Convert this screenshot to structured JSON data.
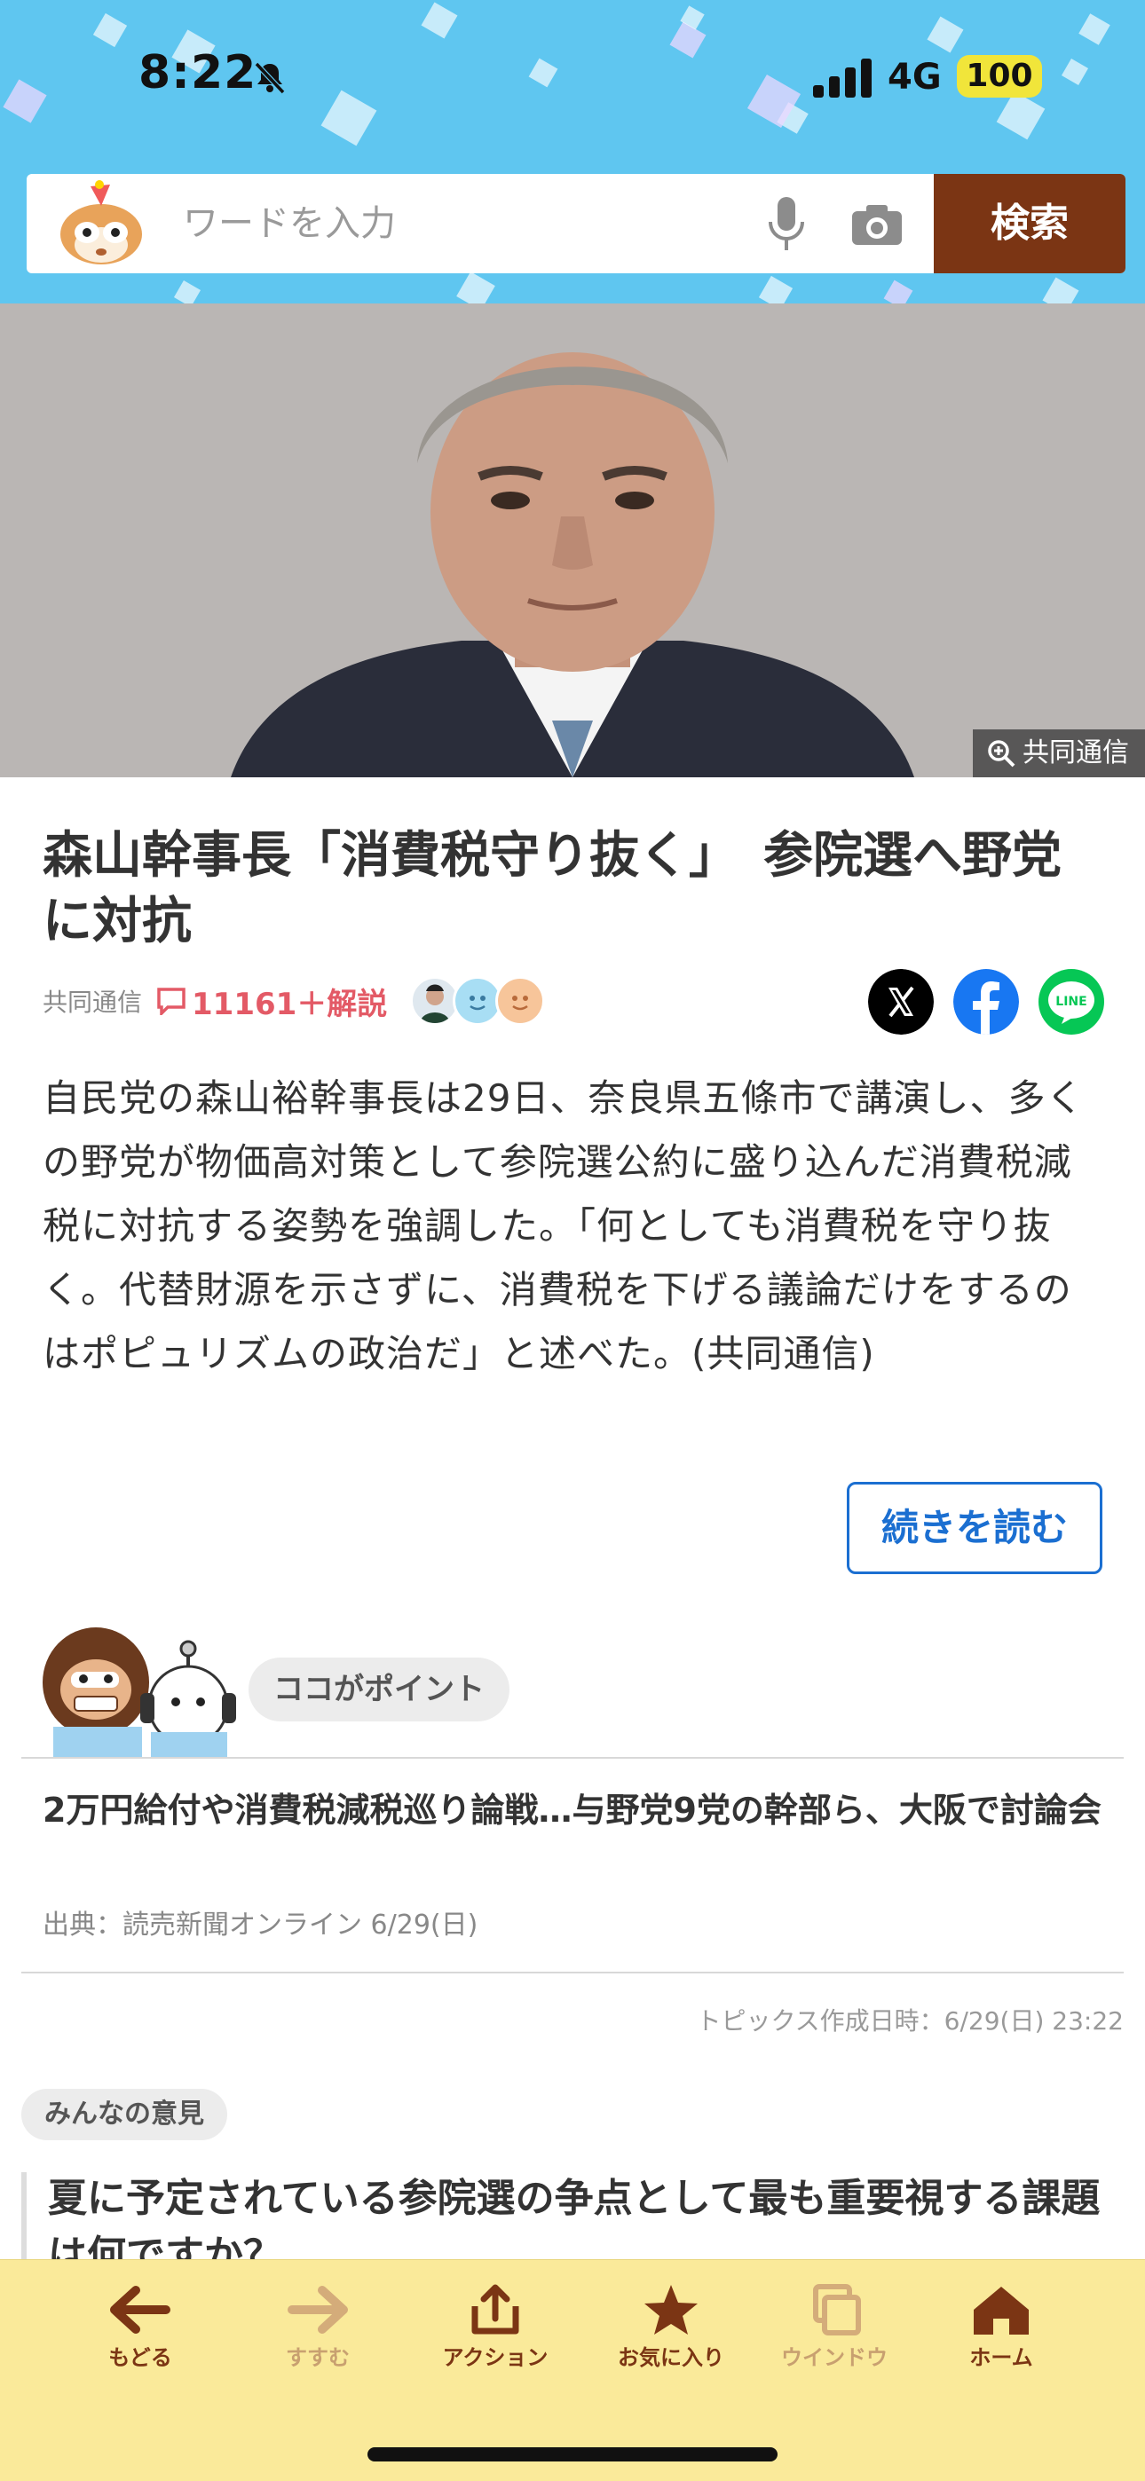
{
  "status": {
    "time": "8:22",
    "network": "4G",
    "battery": "100"
  },
  "search": {
    "placeholder": "ワードを入力",
    "button": "検索"
  },
  "hero": {
    "credit": "共同通信"
  },
  "article": {
    "title": "森山幹事長「消費税守り抜く」　参院選へ野党に対抗",
    "source": "共同通信",
    "comments": "11161＋解説",
    "body": "自民党の森山裕幹事長は29日、奈良県五條市で講演し、多くの野党が物価高対策として参院選公約に盛り込んだ消費税減税に対抗する姿勢を強調した。「何としても消費税を守り抜く。代替財源を示さずに、消費税を下げる議論だけをするのはポピュリズムの政治だ」と述べた。(共同通信)",
    "read_more": "続きを読む"
  },
  "point": {
    "label": "ココがポイント",
    "headline": "2万円給付や消費税減税巡り論戦…与野党9党の幹部ら、大阪で討論会",
    "source": "出典：読売新聞オンライン 6/29(日)",
    "topic_date": "トピックス作成日時：6/29(日) 23:22"
  },
  "opinion": {
    "label": "みんなの意見",
    "question": "夏に予定されている参院選の争点として最も重要視する課題は何ですか？"
  },
  "tabs": [
    {
      "label": "もどる",
      "icon": "arrow-left-icon"
    },
    {
      "label": "すすむ",
      "icon": "arrow-right-icon"
    },
    {
      "label": "アクション",
      "icon": "share-icon"
    },
    {
      "label": "お気に入り",
      "icon": "star-icon"
    },
    {
      "label": "ウインドウ",
      "icon": "window-icon"
    },
    {
      "label": "ホーム",
      "icon": "home-icon"
    }
  ],
  "colors": {
    "header_bg": "#5fc6f0",
    "search_button": "#7b3514",
    "tabbar_bg": "#faea9a",
    "accent_blue": "#1b6fd1",
    "comment_red": "#e35a66"
  }
}
